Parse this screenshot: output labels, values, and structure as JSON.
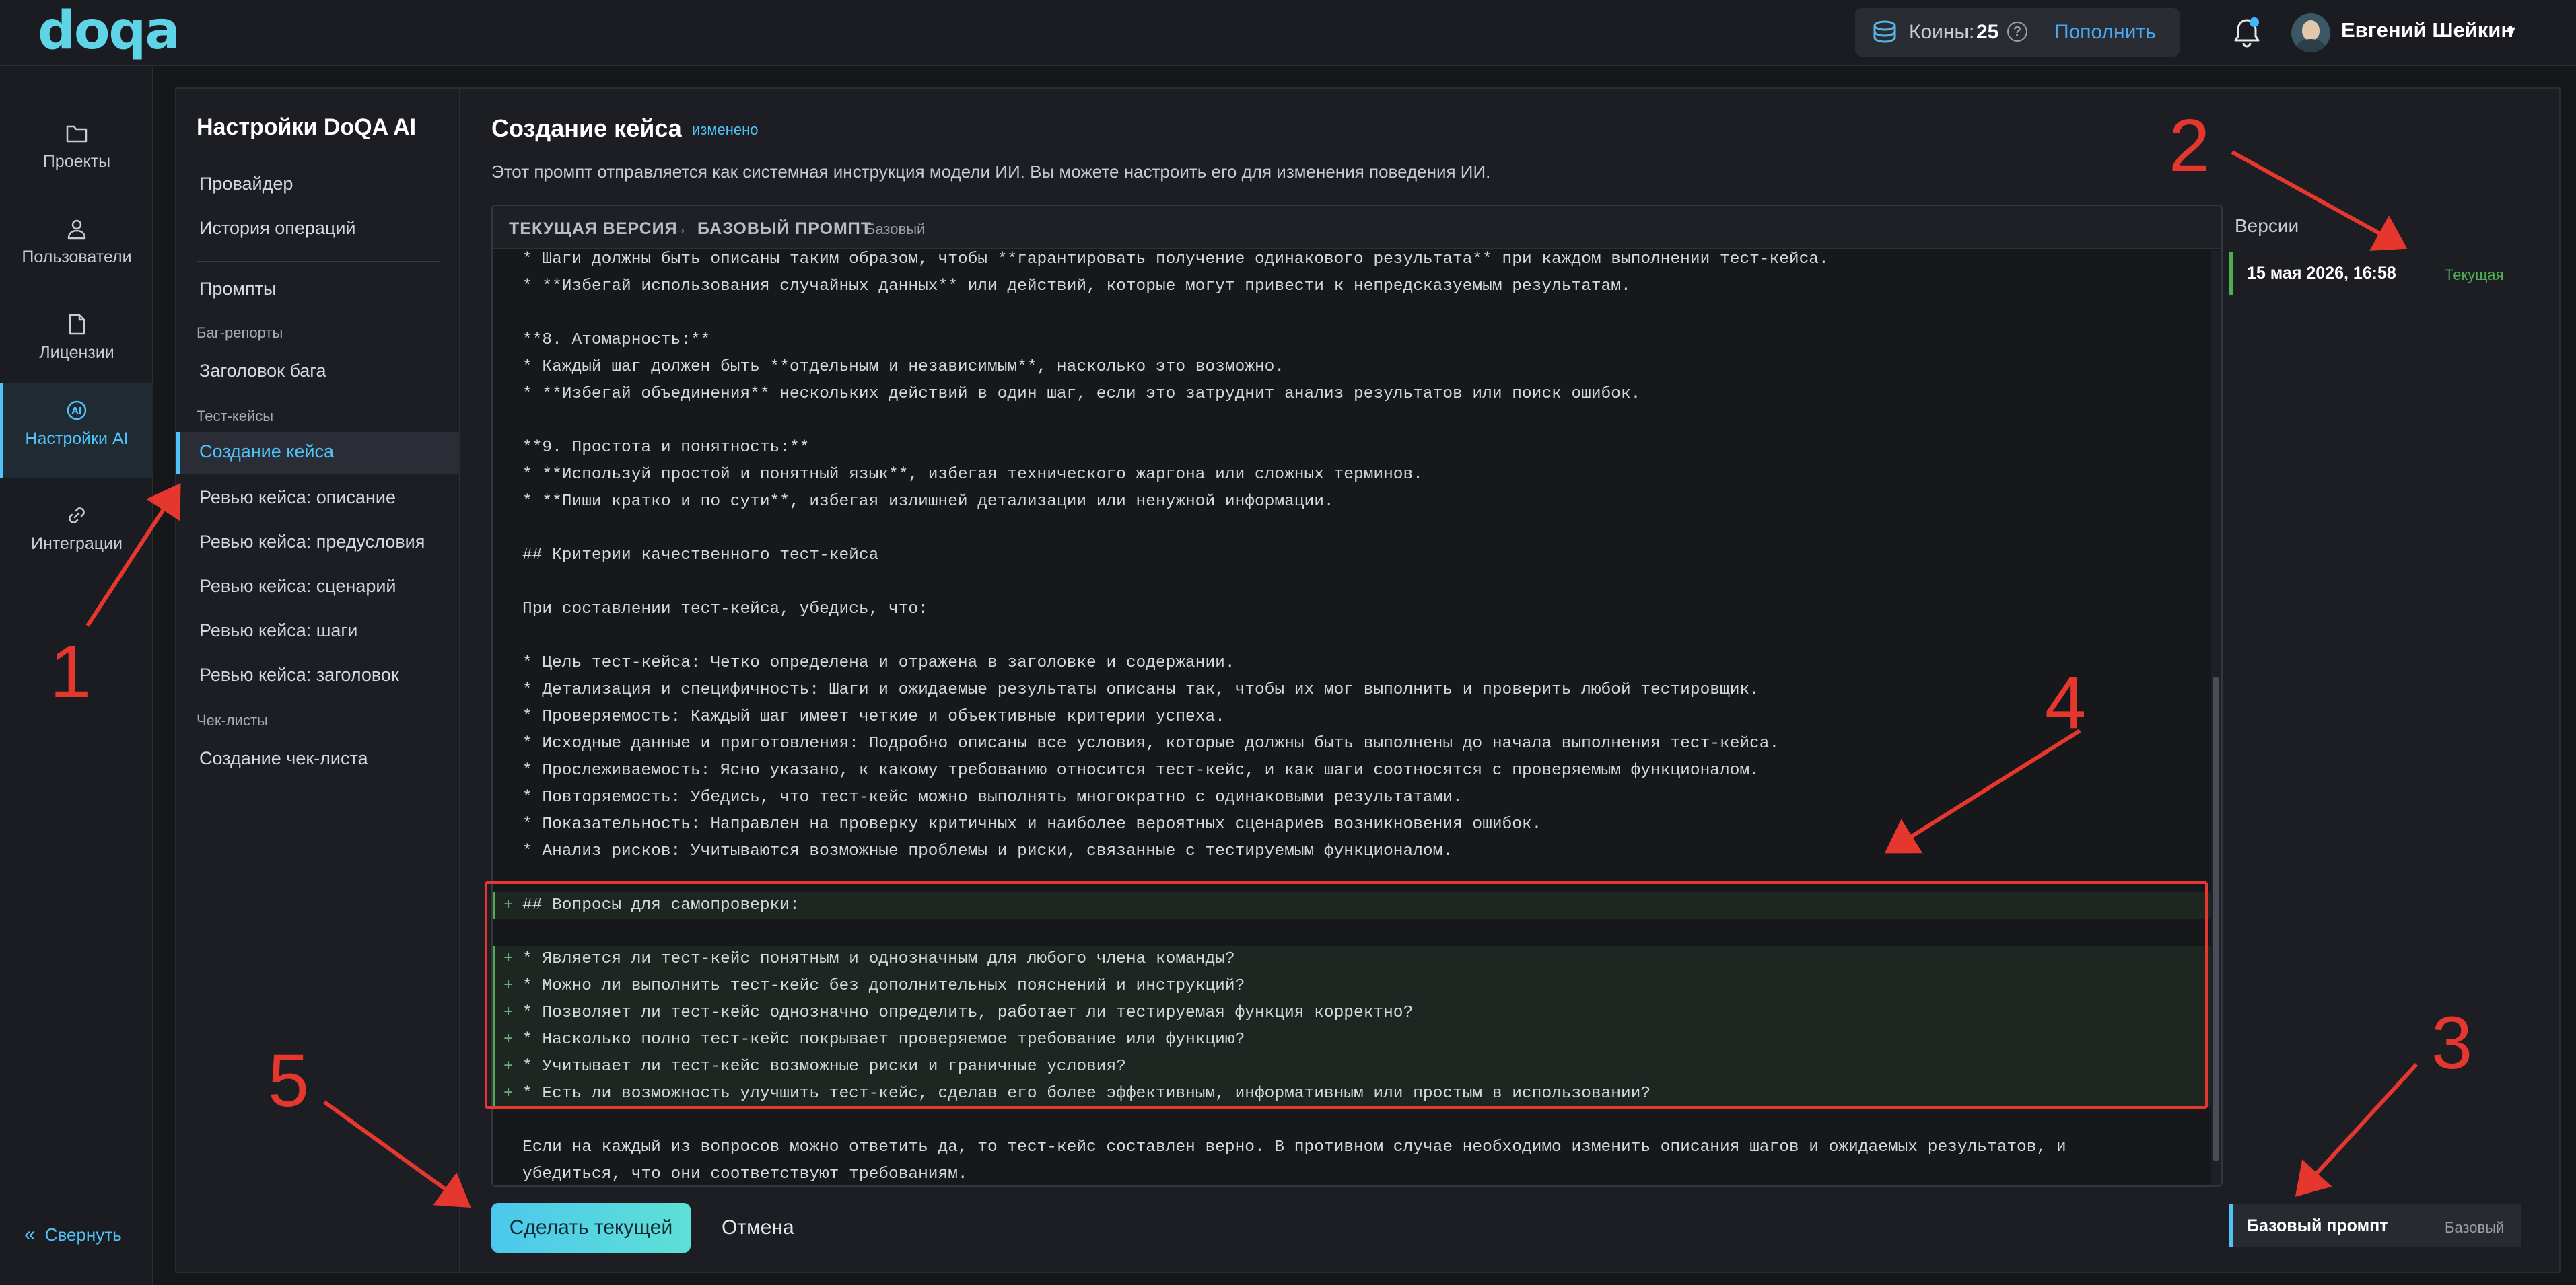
{
  "header": {
    "logo": "doqa",
    "coins_label": "Коины:",
    "coins_value": "25",
    "help": "?",
    "topup": "Пополнить",
    "user_name": "Евгений Шейкин",
    "user_caret": "▾"
  },
  "rail": {
    "items": [
      {
        "label": "Проекты",
        "icon": "folder-icon"
      },
      {
        "label": "Пользователи",
        "icon": "user-icon"
      },
      {
        "label": "Лицензии",
        "icon": "license-icon"
      },
      {
        "label": "Настройки AI",
        "icon": "ai-icon"
      },
      {
        "label": "Интеграции",
        "icon": "link-icon"
      }
    ],
    "collapse": "Свернуть",
    "collapse_icon": "«"
  },
  "settings_nav": {
    "title": "Настройки DoQA AI",
    "provider": "Провайдер",
    "history": "История операций",
    "prompts": "Промпты",
    "group_bugs": "Баг-репорты",
    "bug_title": "Заголовок бага",
    "group_tests": "Тест-кейсы",
    "create_case": "Создание кейса",
    "review_desc": "Ревью кейса: описание",
    "review_pre": "Ревью кейса: предусловия",
    "review_scenario": "Ревью кейса: сценарий",
    "review_steps": "Ревью кейса: шаги",
    "review_title": "Ревью кейса: заголовок",
    "group_checklists": "Чек-листы",
    "create_checklist": "Создание чек-листа"
  },
  "main": {
    "title": "Создание кейса",
    "changed": "изменено",
    "description": "Этот промпт отправляется как системная инструкция модели ИИ. Вы можете настроить его для изменения поведения ИИ.",
    "editor_current": "ТЕКУЩАЯ ВЕРСИЯ",
    "editor_arrow": "→",
    "editor_base": "БАЗОВЫЙ ПРОМПТ",
    "editor_base_tag": "Базовый",
    "lines": [
      {
        "text": "* Шаги должны быть описаны таким образом, чтобы **гарантировать получение одинакового результата** при каждом выполнении тест-кейса.",
        "added": false
      },
      {
        "text": "* **Избегай использования случайных данных** или действий, которые могут привести к непредсказуемым результатам.",
        "added": false
      },
      {
        "text": "",
        "added": false
      },
      {
        "text": "**8. Атомарность:**",
        "added": false
      },
      {
        "text": "* Каждый шаг должен быть **отдельным и независимым**, насколько это возможно.",
        "added": false
      },
      {
        "text": "* **Избегай объединения** нескольких действий в один шаг, если это затруднит анализ результатов или поиск ошибок.",
        "added": false
      },
      {
        "text": "",
        "added": false
      },
      {
        "text": "**9. Простота и понятность:**",
        "added": false
      },
      {
        "text": "* **Используй простой и понятный язык**, избегая технического жаргона или сложных терминов.",
        "added": false
      },
      {
        "text": "* **Пиши кратко и по сути**, избегая излишней детализации или ненужной информации.",
        "added": false
      },
      {
        "text": "",
        "added": false
      },
      {
        "text": "## Критерии качественного тест-кейса",
        "added": false
      },
      {
        "text": "",
        "added": false
      },
      {
        "text": "При составлении тест-кейса, убедись, что:",
        "added": false
      },
      {
        "text": "",
        "added": false
      },
      {
        "text": "* Цель тест-кейса: Четко определена и отражена в заголовке и содержании.",
        "added": false
      },
      {
        "text": "* Детализация и специфичность: Шаги и ожидаемые результаты описаны так, чтобы их мог выполнить и проверить любой тестировщик.",
        "added": false
      },
      {
        "text": "* Проверяемость: Каждый шаг имеет четкие и объективные критерии успеха.",
        "added": false
      },
      {
        "text": "* Исходные данные и приготовления: Подробно описаны все условия, которые должны быть выполнены до начала выполнения тест-кейса.",
        "added": false
      },
      {
        "text": "* Прослеживаемость: Ясно указано, к какому требованию относится тест-кейс, и как шаги соотносятся с проверяемым функционалом.",
        "added": false
      },
      {
        "text": "* Повторяемость: Убедись, что тест-кейс можно выполнять многократно с одинаковыми результатами.",
        "added": false
      },
      {
        "text": "* Показательность: Направлен на проверку критичных и наиболее вероятных сценариев возникновения ошибок.",
        "added": false
      },
      {
        "text": "* Анализ рисков: Учитываются возможные проблемы и риски, связанные с тестируемым функционалом.",
        "added": false
      },
      {
        "text": "",
        "added": false
      },
      {
        "text": "## Вопросы для самопроверки:",
        "added": true
      },
      {
        "text": "",
        "added": false
      },
      {
        "text": "* Является ли тест-кейс понятным и однозначным для любого члена команды?",
        "added": true
      },
      {
        "text": "* Можно ли выполнить тест-кейс без дополнительных пояснений и инструкций?",
        "added": true
      },
      {
        "text": "* Позволяет ли тест-кейс однозначно определить, работает ли тестируемая функция корректно?",
        "added": true
      },
      {
        "text": "* Насколько полно тест-кейс покрывает проверяемое требование или функцию?",
        "added": true
      },
      {
        "text": "* Учитывает ли тест-кейс возможные риски и граничные условия?",
        "added": true
      },
      {
        "text": "* Есть ли возможность улучшить тест-кейс, сделав его более эффективным, информативным или простым в использовании?",
        "added": true
      },
      {
        "text": "",
        "added": false
      },
      {
        "text": "Если на каждый из вопросов можно ответить да, то тест-кейс составлен верно. В противном случае необходимо изменить описания шагов и ожидаемых результатов, и",
        "added": false
      },
      {
        "text": "убедиться, что они соответствуют требованиям.",
        "added": false
      }
    ],
    "plus_sign": "+",
    "make_current": "Сделать текущей",
    "cancel": "Отмена"
  },
  "versions": {
    "title": "Версии",
    "items": [
      {
        "date": "15 мая 2026, 16:58",
        "tag": "Текущая"
      }
    ],
    "base_label": "Базовый промпт",
    "base_tag": "Базовый"
  },
  "annotations": [
    "1",
    "2",
    "3",
    "4",
    "5"
  ],
  "colors": {
    "accent": "#4fc3f7",
    "added_marker": "#4caf50",
    "annotation": "#e5372e"
  }
}
